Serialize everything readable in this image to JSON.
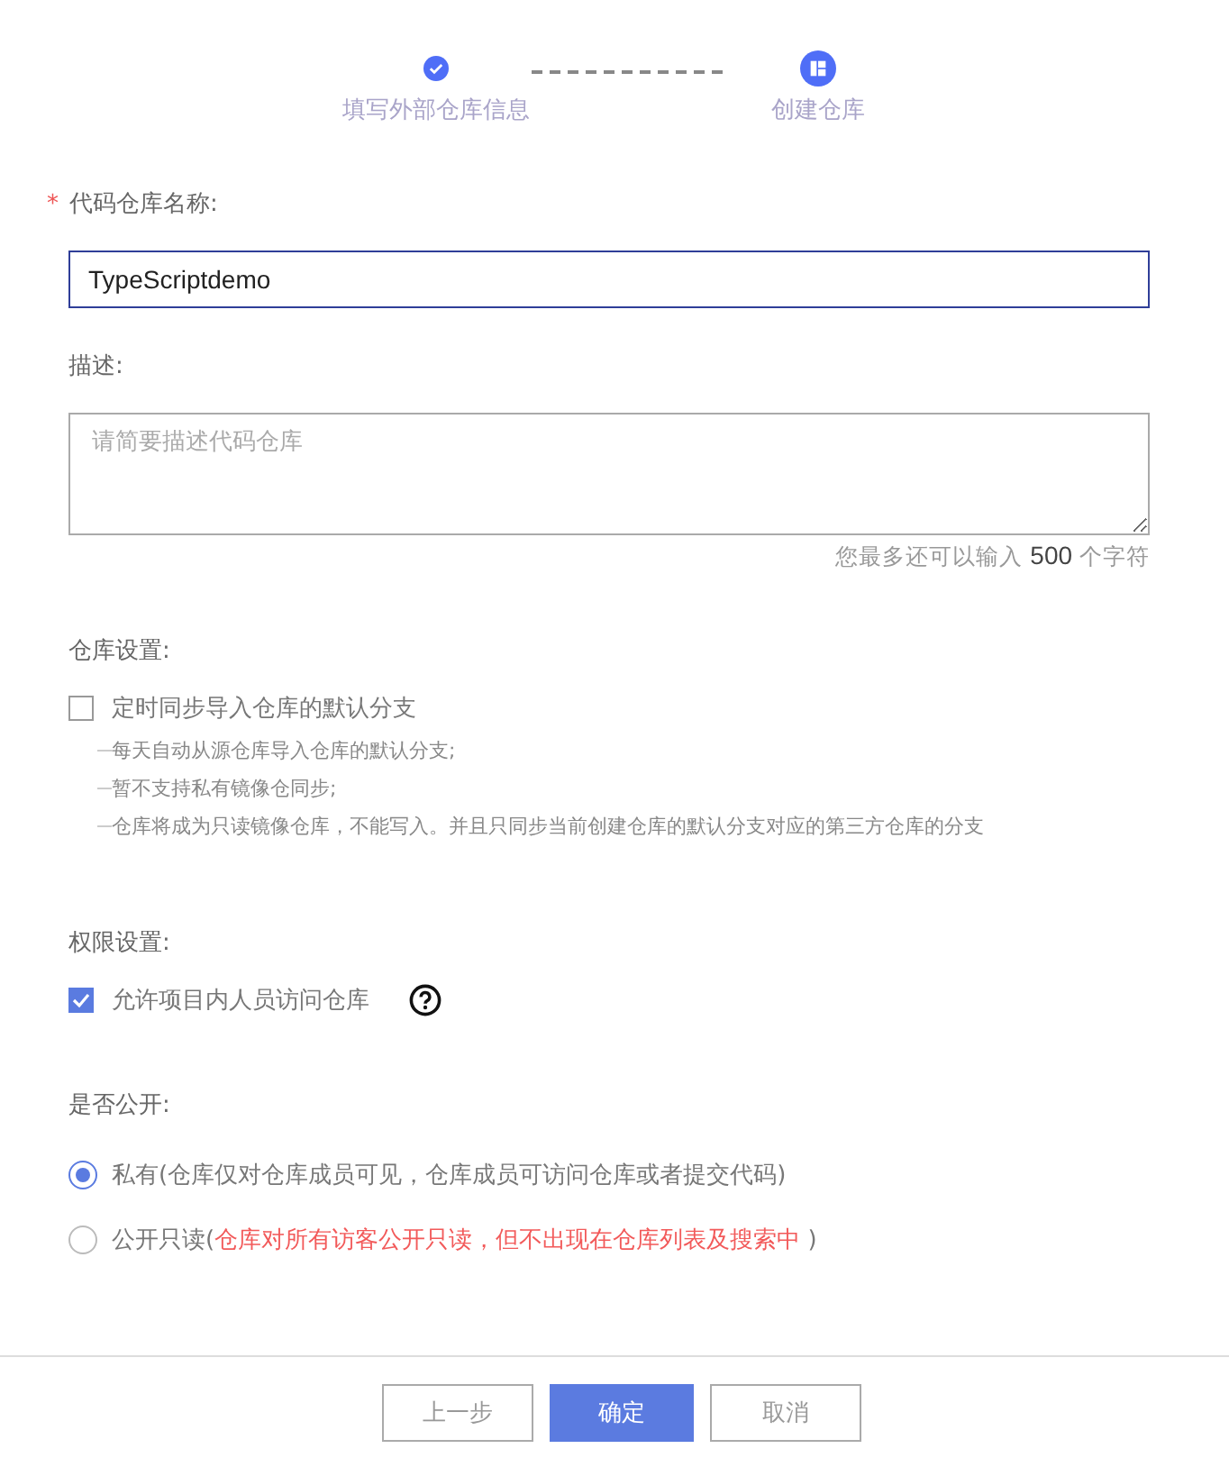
{
  "steps": [
    {
      "label": "填写外部仓库信息",
      "completed": true
    },
    {
      "label": "创建仓库",
      "completed": false
    }
  ],
  "name_field": {
    "required_mark": "*",
    "label": "代码仓库名称:",
    "value": "TypeScriptdemo"
  },
  "description_field": {
    "label": "描述:",
    "placeholder": "请简要描述代码仓库",
    "counter_before": "您最多还可以输入",
    "counter_number": "500",
    "counter_after": "个字符"
  },
  "repo_settings": {
    "label": "仓库设置:",
    "checkbox": {
      "label": "定时同步导入仓库的默认分支",
      "checked": false
    },
    "hints": [
      "每天自动从源仓库导入仓库的默认分支;",
      "暂不支持私有镜像仓同步;",
      "仓库将成为只读镜像仓库，不能写入。并且只同步当前创建仓库的默认分支对应的第三方仓库的分支"
    ]
  },
  "permissions": {
    "label": "权限设置:",
    "checkbox": {
      "label": "允许项目内人员访问仓库",
      "checked": true
    }
  },
  "visibility": {
    "label": "是否公开:",
    "options": [
      {
        "label": "私有(",
        "note": "仓库仅对仓库成员可见，仓库成员可访问仓库或者提交代码",
        "close": ")",
        "warning": false,
        "selected": true
      },
      {
        "label": "公开只读(",
        "note": "仓库对所有访客公开只读，但不出现在仓库列表及搜索中",
        "close": " )",
        "warning": true,
        "selected": false
      }
    ]
  },
  "buttons": [
    {
      "label": "上一步",
      "kind": "secondary"
    },
    {
      "label": "确定",
      "kind": "primary"
    },
    {
      "label": "取消",
      "kind": "secondary"
    }
  ]
}
